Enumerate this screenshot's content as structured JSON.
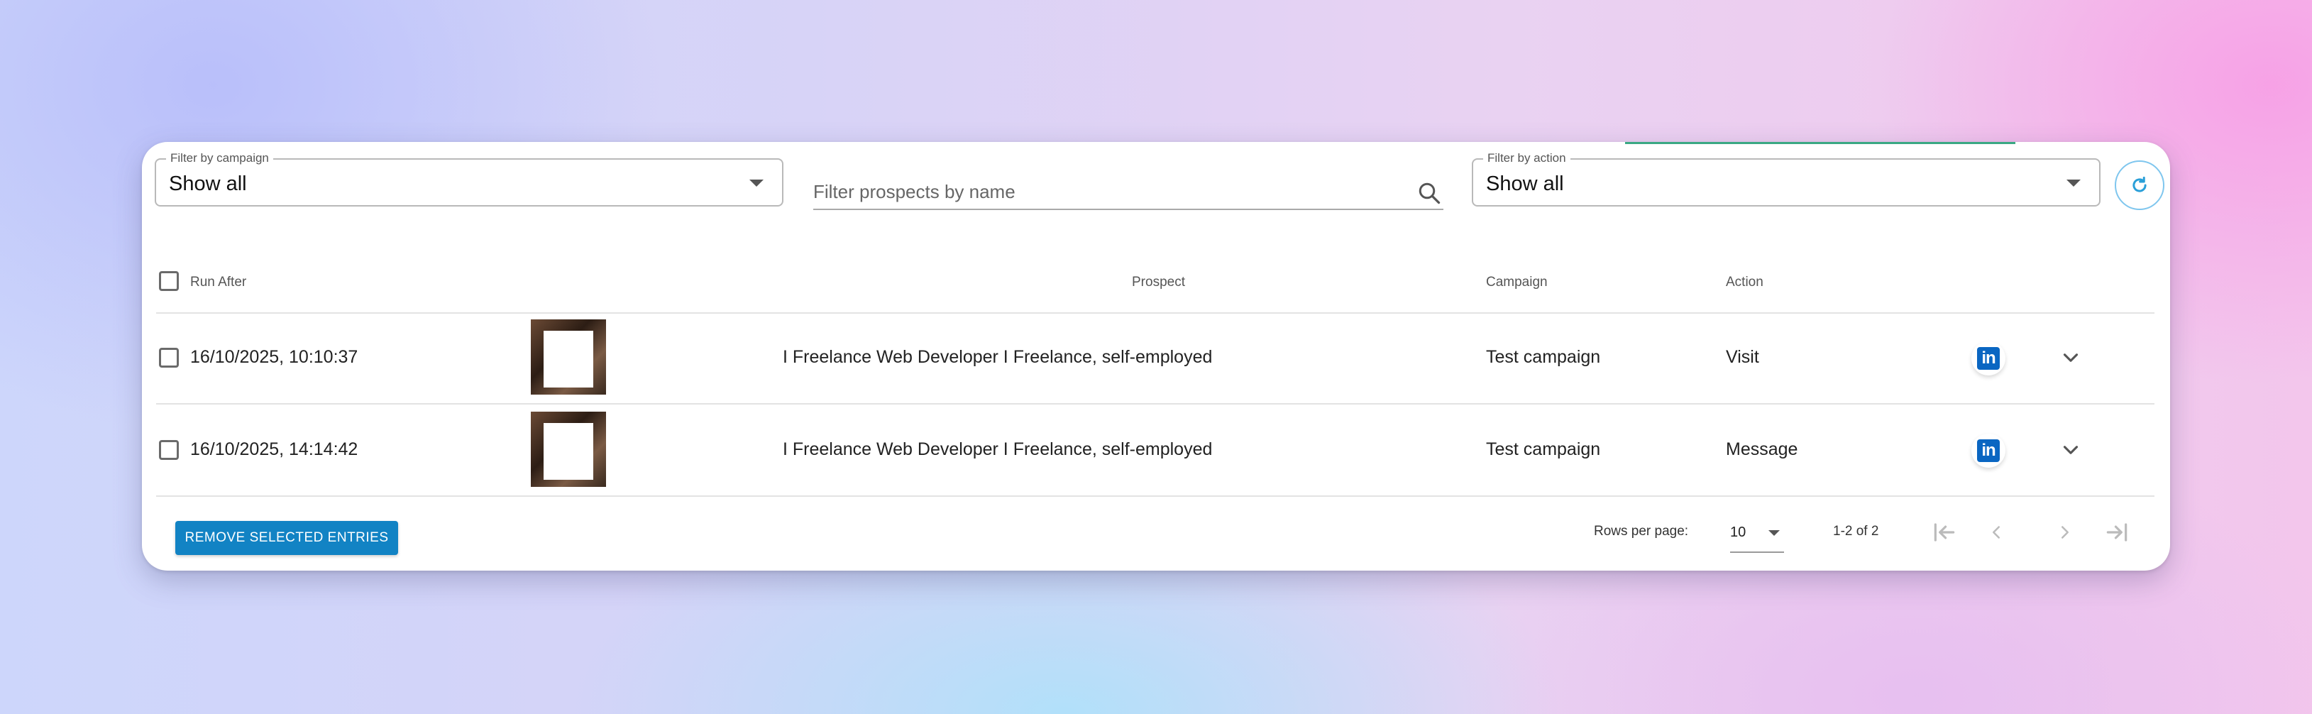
{
  "filters": {
    "campaign": {
      "label": "Filter by campaign",
      "value": "Show all"
    },
    "search": {
      "placeholder": "Filter prospects by name"
    },
    "action": {
      "label": "Filter by action",
      "value": "Show all"
    }
  },
  "table": {
    "headers": {
      "run_after": "Run After",
      "prospect": "Prospect",
      "campaign": "Campaign",
      "action": "Action"
    },
    "rows": [
      {
        "run_after": "16/10/2025, 10:10:37",
        "prospect": "I Freelance Web Developer  I Freelance, self-employed",
        "campaign": "Test campaign",
        "action": "Visit"
      },
      {
        "run_after": "16/10/2025, 14:14:42",
        "prospect": "I Freelance Web Developer  I Freelance, self-employed",
        "campaign": "Test campaign",
        "action": "Message"
      }
    ]
  },
  "footer": {
    "remove_label": "REMOVE SELECTED ENTRIES",
    "rows_per_page_label": "Rows per page:",
    "rows_per_page_value": "10",
    "range": "1-2 of 2"
  },
  "icons": {
    "refresh": "refresh-icon",
    "search": "search-icon",
    "linkedin": "linkedin-icon",
    "expand": "chevron-down-icon",
    "first_page": "first-page-icon",
    "prev_page": "chevron-left-icon",
    "next_page": "chevron-right-icon",
    "last_page": "last-page-icon"
  },
  "colors": {
    "primary": "#1283c4",
    "linkedin": "#0a66c2",
    "accent_line": "#3aa883",
    "refresh_border": "#7fc6ee"
  }
}
